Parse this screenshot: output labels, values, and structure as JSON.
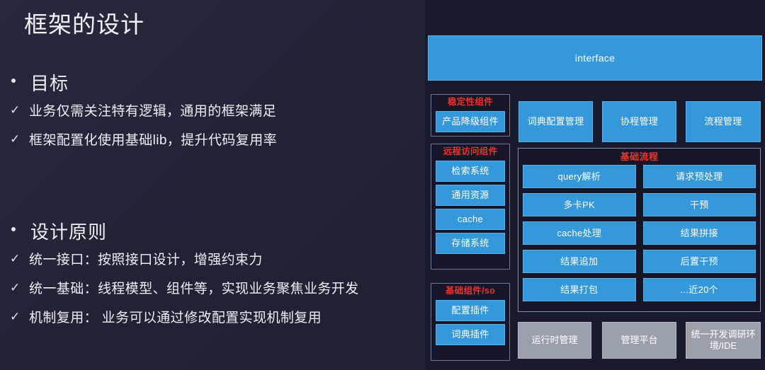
{
  "slide": {
    "title": "框架的设计"
  },
  "sections": [
    {
      "heading": "目标",
      "items": [
        "业务仅需关注特有逻辑，通用的框架满足",
        "框架配置化使用基础lib，提升代码复用率"
      ]
    },
    {
      "heading": "设计原则",
      "items": [
        "统一接口：按照接口设计，增强约束力",
        "统一基础：线程模型、组件等，实现业务聚焦业务开发",
        "机制复用： 业务可以通过修改配置实现机制复用"
      ]
    }
  ],
  "bullets": {
    "dot": "•",
    "check": "✓"
  },
  "diagram": {
    "interface_label": "interface",
    "left_groups": [
      {
        "title": "稳定性组件",
        "items": [
          "产品降级组件"
        ]
      },
      {
        "title": "远程访问组件",
        "items": [
          "检索系统",
          "通用资源",
          "cache",
          "存储系统"
        ]
      },
      {
        "title": "基础组件/so",
        "items": [
          "配置插件",
          "词典插件"
        ]
      }
    ],
    "top_row": [
      "词典配置管理",
      "协程管理",
      "流程管理"
    ],
    "flow": {
      "title": "基础流程",
      "items": [
        "query解析",
        "请求预处理",
        "多卡PK",
        "干预",
        "cache处理",
        "结果拼接",
        "结果追加",
        "后置干预",
        "结果打包",
        "...近20个"
      ]
    },
    "bottom_row": [
      "运行时管理",
      "管理平台",
      "统一开发调研环境/IDE"
    ]
  },
  "colors": {
    "background": "#222236",
    "box_blue": "#3498db",
    "box_gray": "#9aa0aa",
    "group_title_red": "#e8342a",
    "text_white": "#f0f0f5"
  }
}
